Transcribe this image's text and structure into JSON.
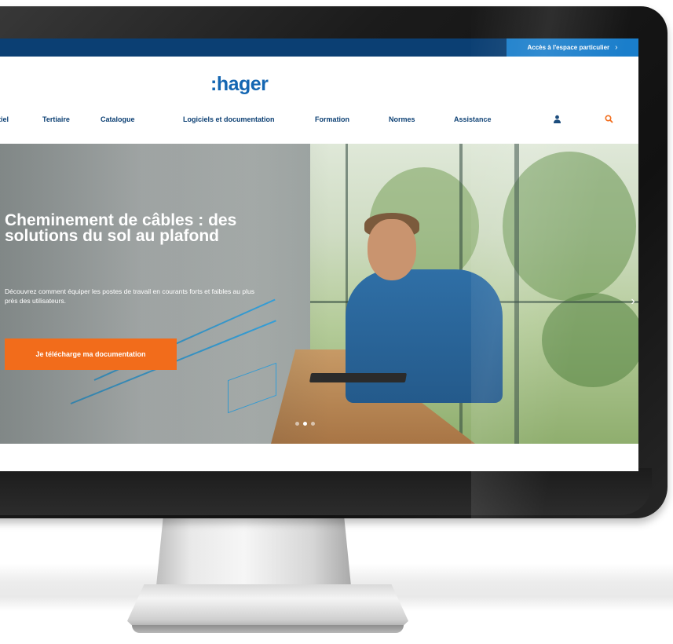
{
  "topbar": {
    "link_label": "Accès à l'espace particulier",
    "link_chevron": "›"
  },
  "header": {
    "logo_text": ":hager"
  },
  "nav": {
    "items": [
      "tiel",
      "Tertiaire",
      "Catalogue",
      "Logiciels et documentation",
      "Formation",
      "Normes",
      "Assistance"
    ],
    "account_icon": "user-icon",
    "search_icon": "search-icon"
  },
  "hero": {
    "title": "Cheminement de câbles : des solutions du sol au plafond",
    "subtitle": "Découvrez comment équiper les postes de travail en courants forts et faibles au plus près des utilisateurs.",
    "cta_label": "Je télécharge ma documentation",
    "next_arrow": "›",
    "slides": 3,
    "active_slide": 2
  },
  "colors": {
    "topbar": "#0b3f73",
    "topbar_link": "#1a7ecb",
    "brand_blue": "#1466b2",
    "nav_text": "#0b3f73",
    "cta": "#f26c1b",
    "search_icon": "#f26c1b"
  }
}
